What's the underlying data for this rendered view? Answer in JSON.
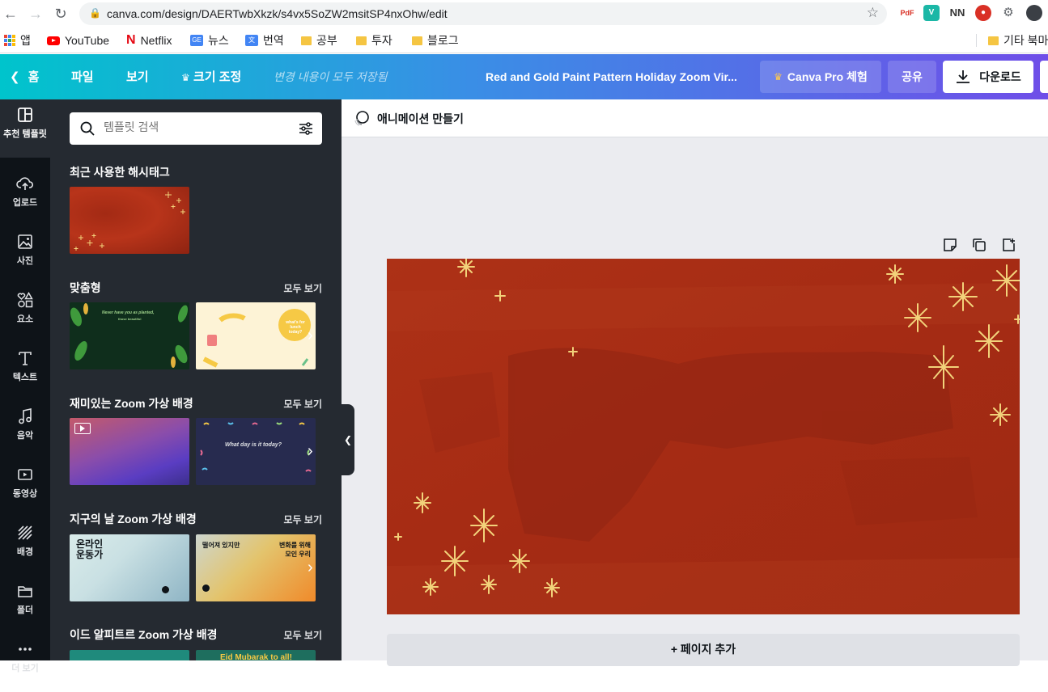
{
  "browser": {
    "url": "canva.com/design/DAERTwbXkzk/s4vx5SoZW2msitSP4nxOhw/edit",
    "bookmarks": [
      {
        "label": "앱",
        "icon": "apps-grid-icon"
      },
      {
        "label": "YouTube",
        "icon": "youtube-icon"
      },
      {
        "label": "Netflix",
        "icon": "netflix-icon"
      },
      {
        "label": "뉴스",
        "icon": "google-news-icon"
      },
      {
        "label": "번역",
        "icon": "translate-icon"
      },
      {
        "label": "공부",
        "icon": "folder-icon"
      },
      {
        "label": "투자",
        "icon": "folder-icon"
      },
      {
        "label": "블로그",
        "icon": "folder-icon"
      },
      {
        "label": "기타 북마",
        "icon": "folder-icon"
      }
    ]
  },
  "header": {
    "home": "홈",
    "file": "파일",
    "view": "보기",
    "resize": "크기 조정",
    "saved_status": "변경 내용이 모두 저장됨",
    "design_title": "Red and Gold Paint Pattern Holiday Zoom Vir...",
    "pro_trial": "Canva Pro 체험",
    "share": "공유",
    "download": "다운로드"
  },
  "rail": [
    {
      "label": "추천 템플릿",
      "icon": "template-icon"
    },
    {
      "label": "업로드",
      "icon": "upload-cloud-icon"
    },
    {
      "label": "사진",
      "icon": "photo-icon"
    },
    {
      "label": "요소",
      "icon": "elements-icon"
    },
    {
      "label": "텍스트",
      "icon": "text-icon"
    },
    {
      "label": "음악",
      "icon": "music-icon"
    },
    {
      "label": "동영상",
      "icon": "video-icon"
    },
    {
      "label": "배경",
      "icon": "background-icon"
    },
    {
      "label": "폴더",
      "icon": "folder-icon"
    },
    {
      "label": "더 보기",
      "icon": "more-icon"
    }
  ],
  "panel": {
    "search_placeholder": "템플릿 검색",
    "see_all": "모두 보기",
    "sections": [
      {
        "title": "최근 사용한 해시태그"
      },
      {
        "title": "맞춤형"
      },
      {
        "title": "재미있는 Zoom 가상 배경"
      },
      {
        "title": "지구의 날 Zoom 가상 배경"
      },
      {
        "title": "이드 알피트르 Zoom 가상 배경"
      }
    ],
    "thumb_texts": {
      "green_line1": "Never have you as planted,",
      "green_line2": "those beautiful",
      "cream_bubble": "what's for lunch today?",
      "navy_text": "What day is it today?",
      "mint_text": "온라인 운동가",
      "sun_text_a": "떨어져 있지만",
      "sun_text_b": "변화를 위해 모인 우리",
      "teal_text": "Eid Mubarak to all!"
    }
  },
  "workspace": {
    "animate": "애니메이션 만들기",
    "add_page": "+ 페이지 추가"
  },
  "colors": {
    "canvas_red": "#a82d14",
    "gold": "#f2d27a",
    "rail_bg": "#0e1318",
    "panel_bg": "#252a31"
  }
}
